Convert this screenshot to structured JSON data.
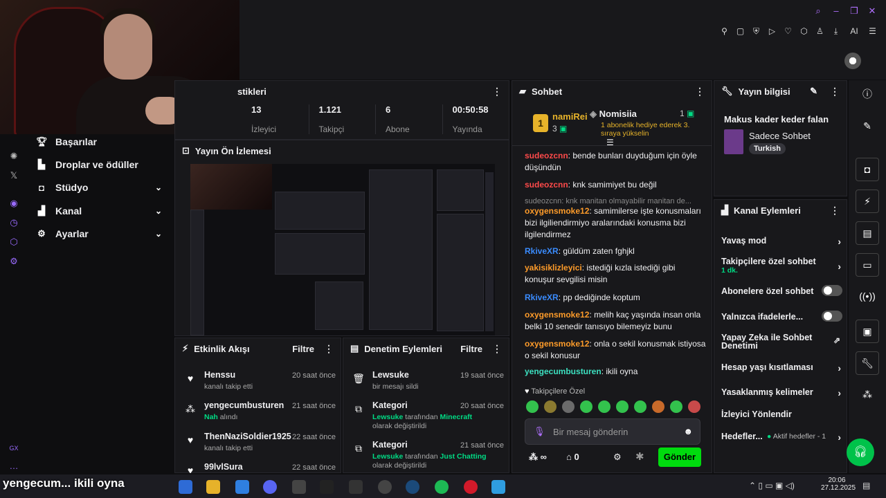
{
  "stats": {
    "title": "stikleri",
    "items": [
      {
        "value": "13",
        "label": "İzleyici"
      },
      {
        "value": "1.121",
        "label": "Takipçi"
      },
      {
        "value": "6",
        "label": "Abone"
      },
      {
        "value": "00:50:58",
        "label": "Yayında"
      }
    ]
  },
  "menu": [
    {
      "label": "Başarılar",
      "icon": "trophy-icon"
    },
    {
      "label": "Droplar ve ödüller",
      "icon": "gift-icon"
    },
    {
      "label": "Stüdyo",
      "icon": "camera-icon"
    },
    {
      "label": "Kanal",
      "icon": "user-icon"
    },
    {
      "label": "Ayarlar",
      "icon": "gear-icon"
    }
  ],
  "left_strip_label": "GX",
  "preview": {
    "title": "Yayın Ön İzlemesi"
  },
  "feed": {
    "title": "Etkinlik Akışı",
    "filter": "Filtre",
    "items": [
      {
        "name": "Henssu",
        "sub": "kanalı takip etti",
        "time": "20 saat önce",
        "icon": "heart-icon"
      },
      {
        "name": "yengecumbusturen",
        "sub_green": "Nah",
        "sub": "alındı",
        "time": "21 saat önce",
        "icon": "points-icon"
      },
      {
        "name": "ThenNaziSoldier1925",
        "sub": "kanalı takip etti",
        "time": "22 saat önce",
        "icon": "heart-icon"
      },
      {
        "name": "99lvlSura",
        "sub": "",
        "time": "22 saat önce",
        "icon": "heart-icon"
      }
    ]
  },
  "mod": {
    "title": "Denetim Eylemleri",
    "filter": "Filtre",
    "items": [
      {
        "name": "Lewsuke",
        "sub": "bir mesajı sildi",
        "time": "19 saat önce",
        "icon": "trash-icon"
      },
      {
        "name": "Kategori",
        "who": "Lewsuke",
        "mid": "tarafından",
        "game": "Minecraft",
        "tail": "olarak değiştirildi",
        "time": "20 saat önce",
        "icon": "category-icon"
      },
      {
        "name": "Kategori",
        "who": "Lewsuke",
        "mid": "tarafından",
        "game": "Just Chatting",
        "tail": "olarak değiştirildi",
        "time": "21 saat önce",
        "icon": "category-icon"
      }
    ]
  },
  "chat": {
    "title": "Sohbet",
    "top_user": "namiRei",
    "top_count": "3",
    "top_rank": "1",
    "second_user": "Nomisiia",
    "second_count": "1",
    "second_note": "1 abonelik hediye ederek 3. sıraya yükselin",
    "messages": [
      {
        "user": "sudeozcnn",
        "color": "#ff4a4a",
        "text": "bende bunları duyduğum için öyle düşündün"
      },
      {
        "user": "sudeozcnn",
        "color": "#ff4a4a",
        "text": "knk samimiyet bu değil"
      },
      {
        "reply": "sudeozcnn: knk manitan olmayabilir manitan de..."
      },
      {
        "user": "oxygensmoke12",
        "color": "#ff9c2a",
        "text": "samimilerse işte konusmaları bizi ilgiliendirmiyo aralarındaki konusma bizi ilgilendirmez"
      },
      {
        "user": "RkiveXR",
        "color": "#3a8cff",
        "text": "güldüm zaten fghjkl"
      },
      {
        "user": "yakisiklizleyici",
        "color": "#ff9c2a",
        "text": "istediği kızla istediği gibi konuşur sevgilisi misin"
      },
      {
        "user": "RkiveXR",
        "color": "#3a8cff",
        "text": "pp dediğinde koptum"
      },
      {
        "user": "oxygensmoke12",
        "color": "#ff9c2a",
        "text": "melih kaç yaşında insan onla belki 10 senedir tanısıyo bilemeyiz bunu"
      },
      {
        "user": "oxygensmoke12",
        "color": "#ff9c2a",
        "text": "onla o sekil konusmak istiyosa o sekil konusur"
      },
      {
        "user": "yengecumbusturen",
        "color": "#3ce0c0",
        "text": "ikili oyna"
      }
    ],
    "followers_label": "Takipçilere Özel",
    "input_placeholder": "Bir mesaj gönderin",
    "points": "∞",
    "gifts": "0",
    "send": "Gönder"
  },
  "info": {
    "title": "Yayın bilgisi",
    "stream_title": "Makus kader keder falan",
    "category": "Sadece Sohbet",
    "tag": "Turkish"
  },
  "actions": {
    "title": "Kanal Eylemleri",
    "items": [
      {
        "label": "Yavaş mod",
        "type": "chevron"
      },
      {
        "label": "Takipçilere özel sohbet",
        "sub": "1 dk.",
        "type": "chevron"
      },
      {
        "label": "Abonelere özel sohbet",
        "type": "toggle"
      },
      {
        "label": "Yalnızca ifadelerle...",
        "type": "toggle"
      },
      {
        "label": "Yapay Zeka ile Sohbet Denetimi",
        "type": "external"
      },
      {
        "label": "Hesap yaşı kısıtlaması",
        "type": "chevron"
      },
      {
        "label": "Yasaklanmış kelimeler",
        "type": "chevron"
      },
      {
        "label": "İzleyici Yönlendir",
        "type": "none"
      },
      {
        "label": "Hedefler...",
        "extra": "Aktif hedefler - 1",
        "type": "chevron"
      }
    ]
  },
  "taskbar": {
    "overlay_text": "yengecum... ikili oyna",
    "time": "20:06",
    "date": "27.12.2025"
  },
  "colors": {
    "accent": "#00db0e",
    "purple": "#9147ff",
    "panel": "#18181b"
  }
}
